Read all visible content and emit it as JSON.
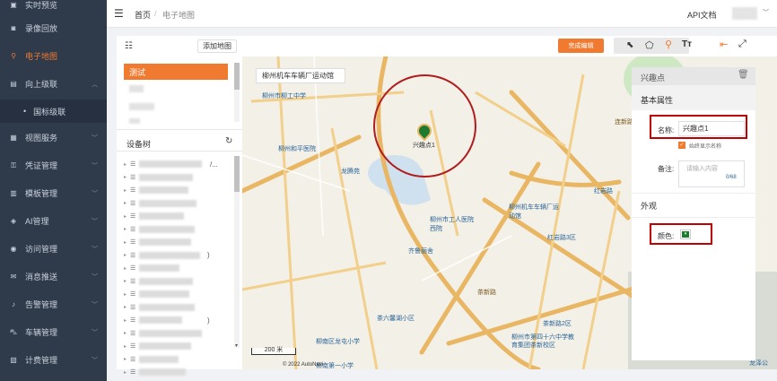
{
  "sidebar": {
    "items": [
      {
        "label": "实时预览",
        "icon": "video-icon",
        "chevron": false
      },
      {
        "label": "录像回放",
        "icon": "playback-icon",
        "chevron": false
      },
      {
        "label": "电子地图",
        "icon": "map-icon",
        "chevron": false,
        "active": true
      },
      {
        "label": "向上级联",
        "icon": "cascade-icon",
        "chevron": true,
        "expanded": true
      },
      {
        "label": "视图服务",
        "icon": "view-icon",
        "chevron": true
      },
      {
        "label": "凭证管理",
        "icon": "key-icon",
        "chevron": true
      },
      {
        "label": "模板管理",
        "icon": "template-icon",
        "chevron": true
      },
      {
        "label": "AI管理",
        "icon": "ai-icon",
        "chevron": true
      },
      {
        "label": "访问管理",
        "icon": "user-icon",
        "chevron": true
      },
      {
        "label": "消息推送",
        "icon": "message-icon",
        "chevron": true
      },
      {
        "label": "告警管理",
        "icon": "alarm-icon",
        "chevron": true
      },
      {
        "label": "车辆管理",
        "icon": "car-icon",
        "chevron": true
      },
      {
        "label": "计费管理",
        "icon": "billing-icon",
        "chevron": true
      }
    ],
    "sub_item": "国标级联"
  },
  "header": {
    "breadcrumb_home": "首页",
    "breadcrumb_sep": "/",
    "breadcrumb_current": "电子地图",
    "api_docs": "API文档"
  },
  "left_panel": {
    "add_map_button": "添加地图",
    "selected_map": "测试",
    "device_tree_title": "设备树",
    "tree_rows": 17,
    "tree_visible_fragments": [
      "/...",
      ")",
      ")"
    ]
  },
  "map_toolbar": {
    "finish_edit_button": "完成编辑",
    "text_tool_glyph": "Tт"
  },
  "map": {
    "search_value": "柳州机车车辆厂运动馆",
    "marker_label": "兴趣点1",
    "scale_label": "200 米",
    "copyright": "© 2022 AutoNavi",
    "pois": [
      "柳州市柳工中学",
      "柳州和平医院",
      "龙腾苑",
      "柳州市工人医院西院",
      "柳州机车车辆厂运动馆",
      "齐鲁丽舍",
      "红岩路3区",
      "红岩路",
      "茶六馨湖小区",
      "茶新路2区",
      "柳南区龙屯小学",
      "柳州市第四十六中学教育集团茶新校区",
      "柳南第一小学",
      "茶新路",
      "龙泽公",
      "连新路"
    ]
  },
  "properties": {
    "title": "兴趣点",
    "section_basic": "基本属性",
    "name_label": "名称:",
    "name_value": "兴趣点1",
    "always_show_label": "始终显示名称",
    "remark_label": "备注:",
    "remark_placeholder": "请输入内容",
    "remark_counter": "0/68",
    "section_appearance": "外观",
    "color_label": "颜色:",
    "color_value": "#1e7a2e"
  },
  "colors": {
    "accent": "#f07a2f",
    "sidebar_bg": "#2f3a4a",
    "annotation_red": "#c00000"
  }
}
